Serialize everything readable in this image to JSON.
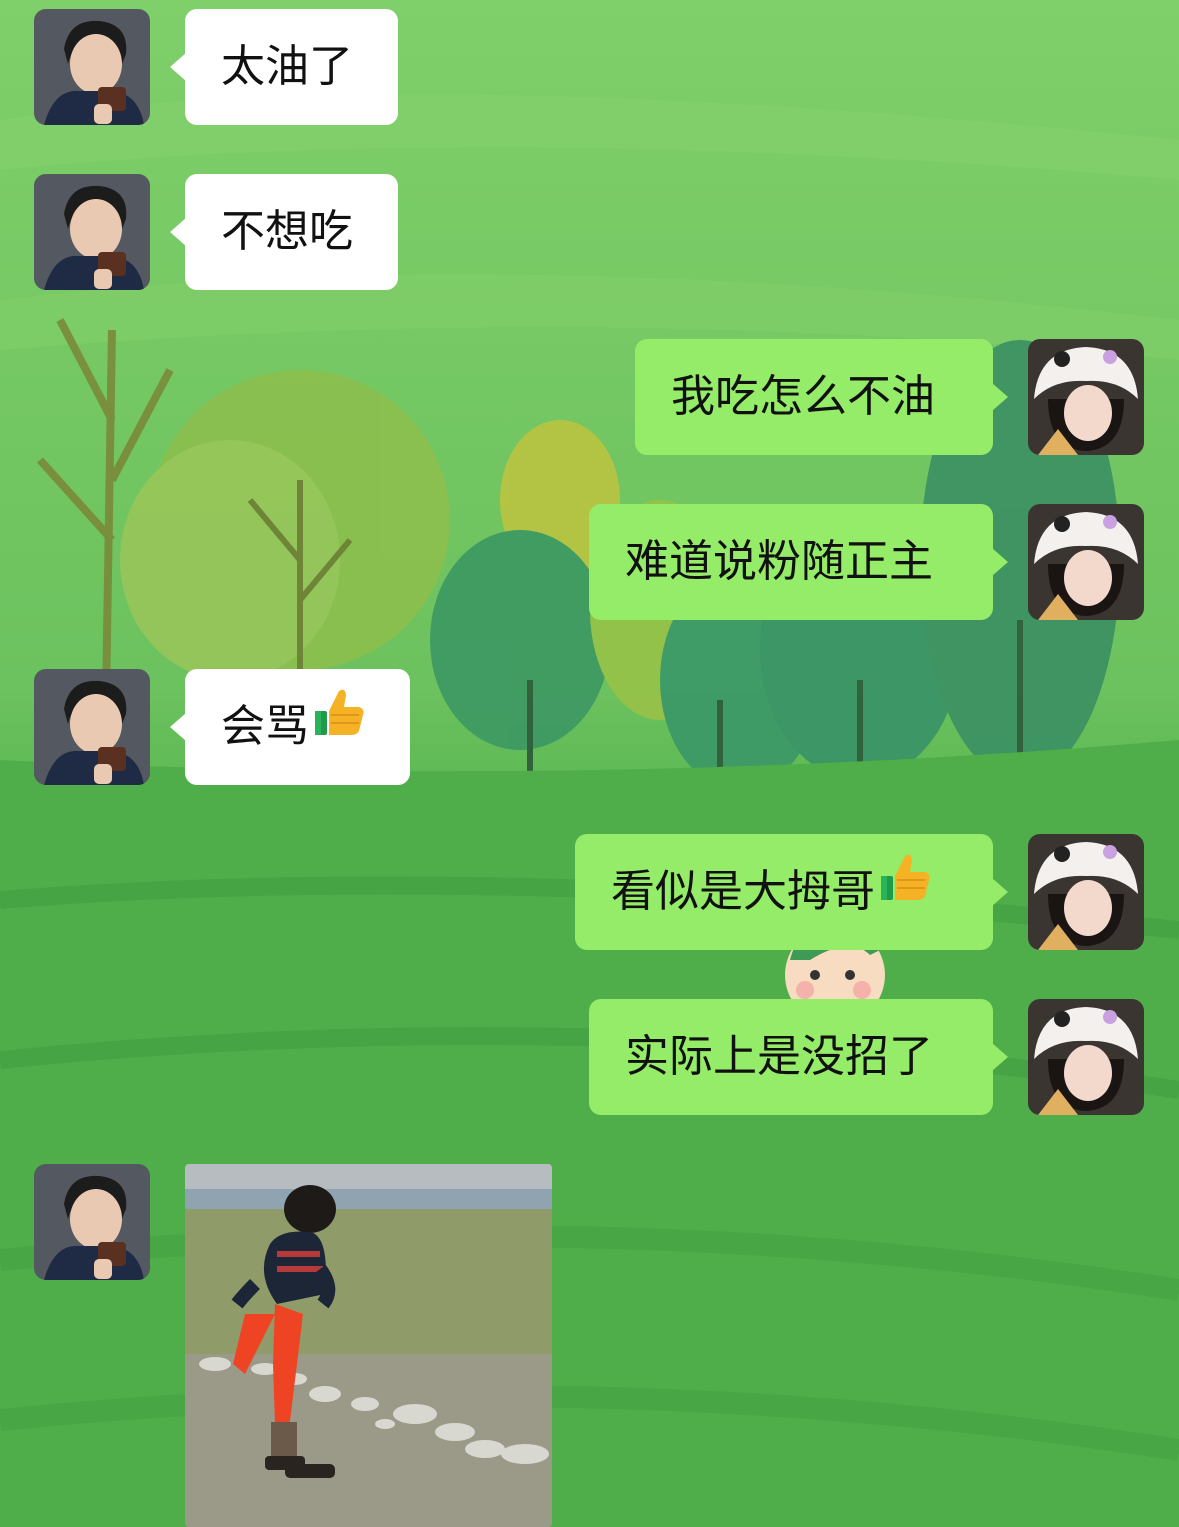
{
  "chat": {
    "messages": [
      {
        "side": "left",
        "text": "太油了"
      },
      {
        "side": "left",
        "text": "不想吃"
      },
      {
        "side": "right",
        "text": "我吃怎么不油"
      },
      {
        "side": "right",
        "text": "难道说粉随正主"
      },
      {
        "side": "left",
        "text": "会骂",
        "emoji": "thumbs-up-icon"
      },
      {
        "side": "right",
        "text": "看似是大拇哥",
        "emoji": "thumbs-up-icon"
      },
      {
        "side": "right",
        "text": "实际上是没招了"
      },
      {
        "side": "left",
        "type": "image",
        "image": "child-in-sweater-on-grass-photo"
      }
    ]
  },
  "colors": {
    "bubble_sent": "#95ec69",
    "bubble_received": "#ffffff",
    "wallpaper": "#5cb552"
  }
}
